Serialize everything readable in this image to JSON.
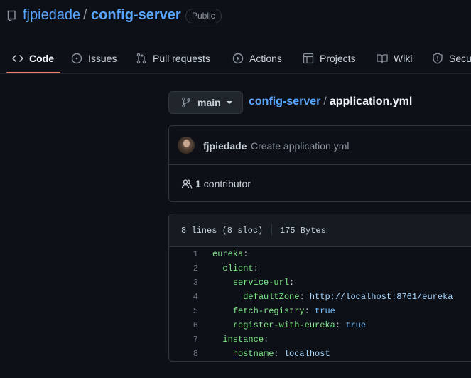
{
  "repo": {
    "owner": "fjpiedade",
    "separator": "/",
    "name": "config-server",
    "visibility": "Public",
    "icon": "repo-icon"
  },
  "tabs": [
    {
      "label": "Code",
      "icon": "code-icon",
      "active": true
    },
    {
      "label": "Issues",
      "icon": "issue-opened-icon"
    },
    {
      "label": "Pull requests",
      "icon": "git-pull-request-icon"
    },
    {
      "label": "Actions",
      "icon": "play-icon"
    },
    {
      "label": "Projects",
      "icon": "table-icon"
    },
    {
      "label": "Wiki",
      "icon": "book-icon"
    },
    {
      "label": "Secu",
      "icon": "shield-icon"
    }
  ],
  "branch": {
    "label": "main",
    "icon": "git-branch-icon"
  },
  "breadcrumb": {
    "repo": "config-server",
    "separator": "/",
    "file": "application.yml"
  },
  "commit": {
    "author": "fjpiedade",
    "message": "Create application.yml",
    "contributors_count": "1",
    "contributors_label": "contributor"
  },
  "file": {
    "lines_info": "8 lines (8 sloc)",
    "size": "175 Bytes"
  },
  "code_lines": [
    {
      "num": "1",
      "indent": "",
      "key": "eureka",
      "colon": ":",
      "value": "",
      "value_type": ""
    },
    {
      "num": "2",
      "indent": "  ",
      "key": "client",
      "colon": ":",
      "value": "",
      "value_type": ""
    },
    {
      "num": "3",
      "indent": "    ",
      "key": "service-url",
      "colon": ":",
      "value": "",
      "value_type": ""
    },
    {
      "num": "4",
      "indent": "      ",
      "key": "defaultZone",
      "colon": ":",
      "value": "http://localhost:8761/eureka",
      "value_type": "string"
    },
    {
      "num": "5",
      "indent": "    ",
      "key": "fetch-registry",
      "colon": ":",
      "value": "true",
      "value_type": "bool"
    },
    {
      "num": "6",
      "indent": "    ",
      "key": "register-with-eureka",
      "colon": ":",
      "value": "true",
      "value_type": "bool"
    },
    {
      "num": "7",
      "indent": "  ",
      "key": "instance",
      "colon": ":",
      "value": "",
      "value_type": ""
    },
    {
      "num": "8",
      "indent": "    ",
      "key": "hostname",
      "colon": ":",
      "value": "localhost",
      "value_type": "string"
    }
  ],
  "colors": {
    "background": "#0d1117",
    "link": "#58a6ff",
    "active_tab_underline": "#f78166",
    "yaml_key": "#7ee787",
    "yaml_string": "#a5d6ff",
    "yaml_bool": "#79c0ff"
  }
}
